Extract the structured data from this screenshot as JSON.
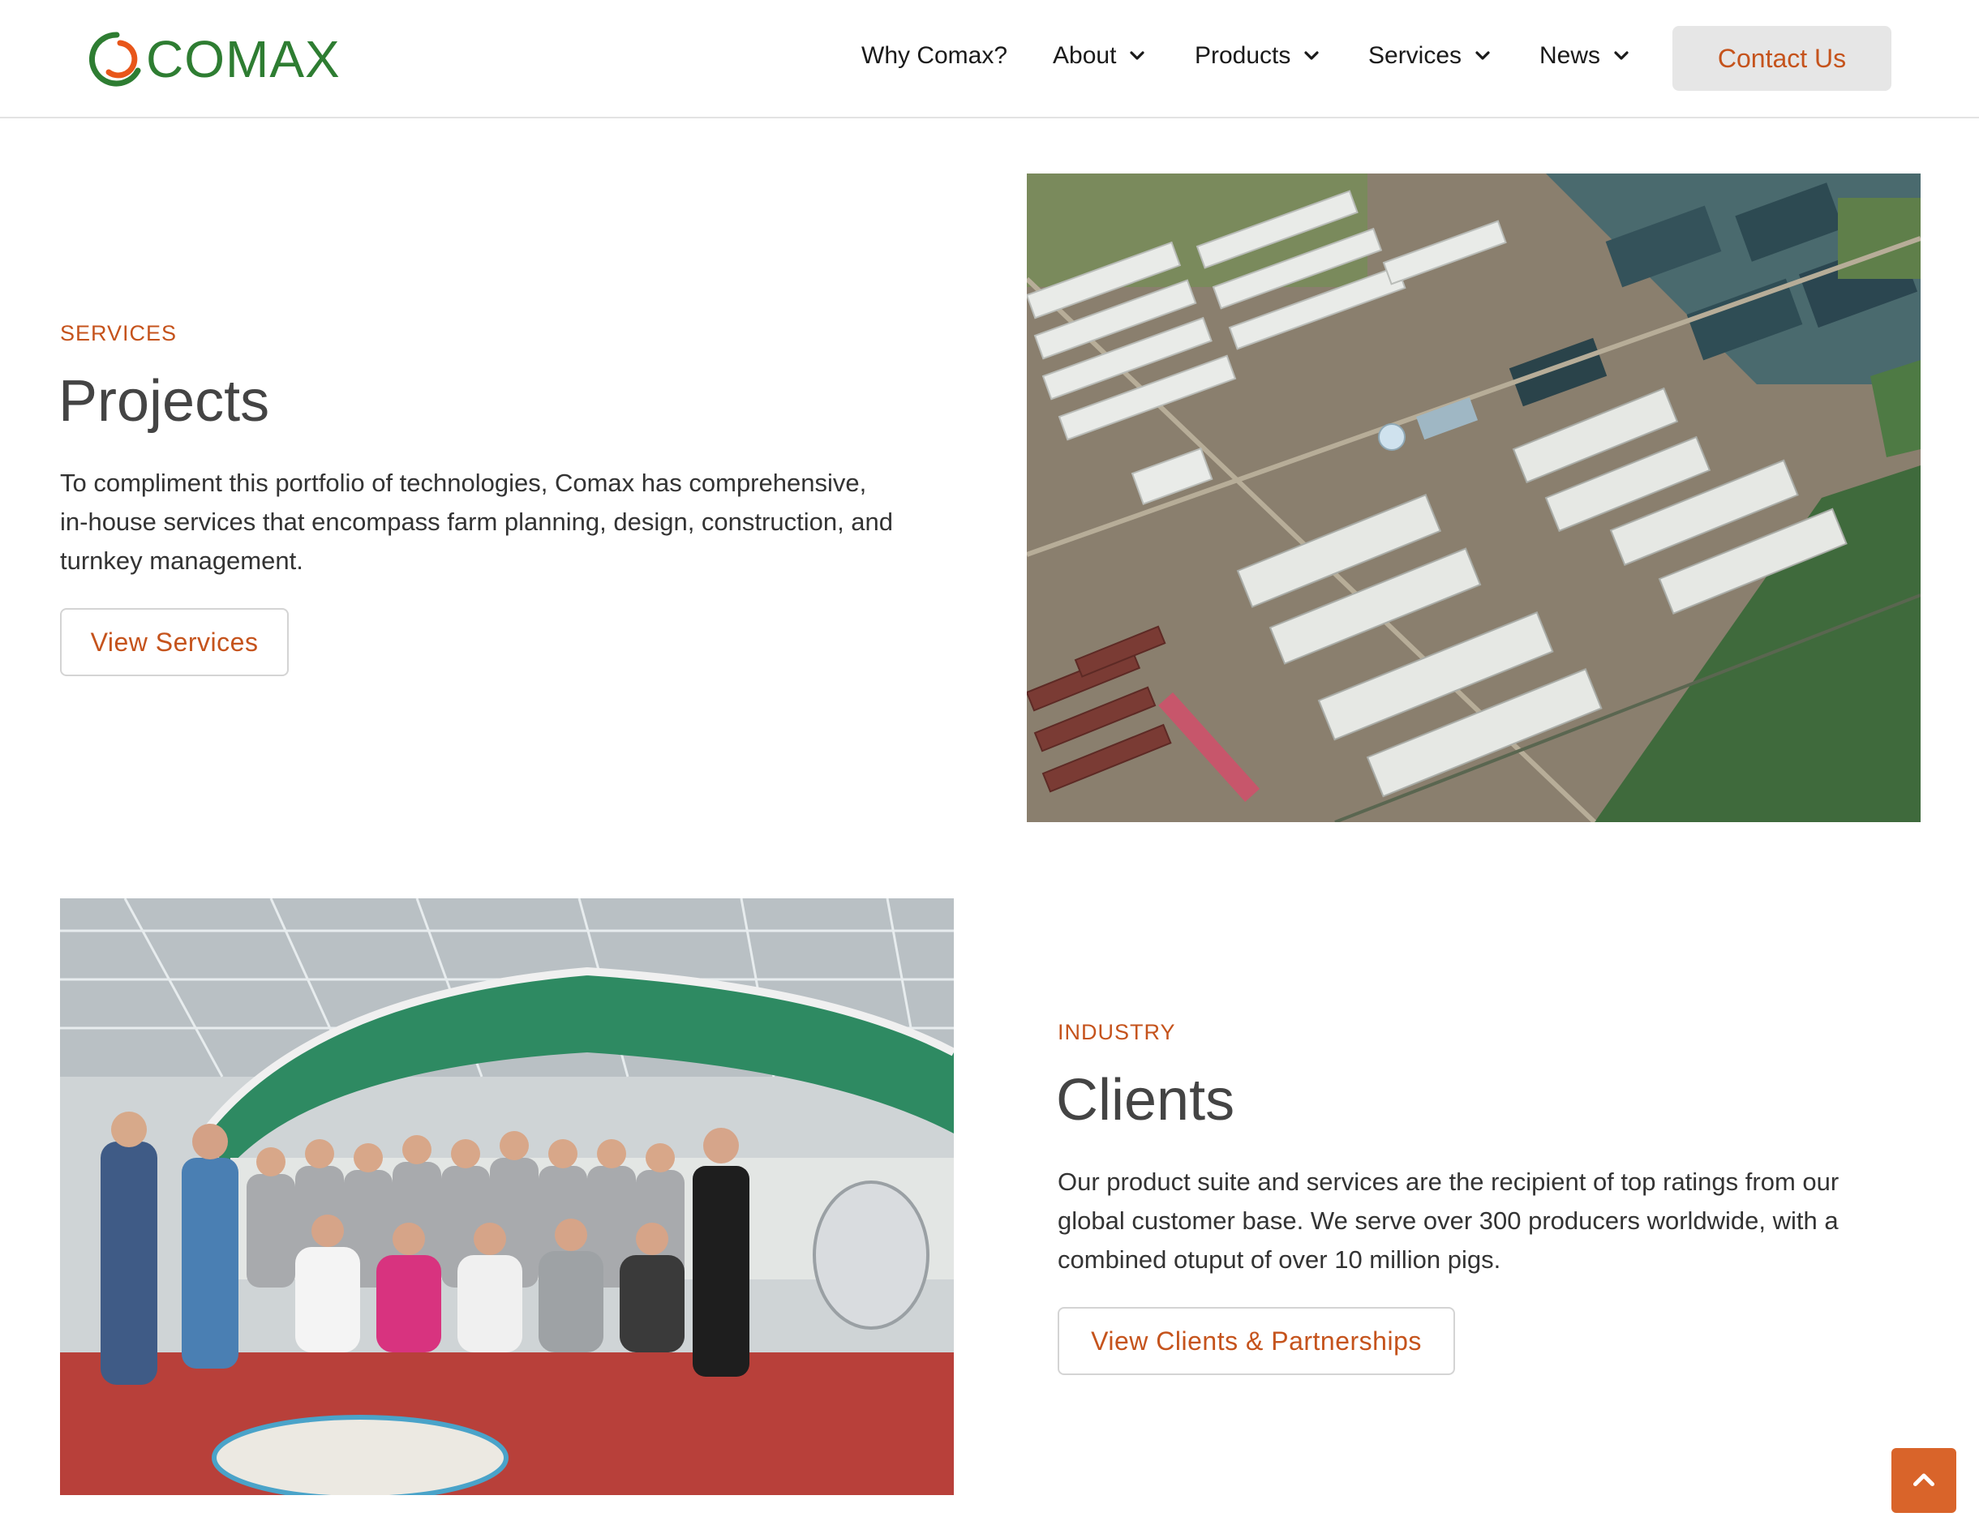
{
  "brand": {
    "name": "COMAX",
    "accent": "#c5531c",
    "logo_green": "#2e7d32"
  },
  "nav": {
    "items": [
      {
        "label": "Why Comax?",
        "has_dropdown": false
      },
      {
        "label": "About",
        "has_dropdown": true
      },
      {
        "label": "Products",
        "has_dropdown": true
      },
      {
        "label": "Services",
        "has_dropdown": true
      },
      {
        "label": "News",
        "has_dropdown": true
      }
    ],
    "contact_label": "Contact Us"
  },
  "projects": {
    "eyebrow": "SERVICES",
    "title": "Projects",
    "body_lines": [
      "To compliment this portfolio of technologies, Comax has comprehensive,",
      "in-house services that encompass farm planning, design, construction, and",
      "turnkey management."
    ],
    "button_label": "View Services"
  },
  "clients": {
    "eyebrow": "INDUSTRY",
    "title": "Clients",
    "body_lines": [
      "Our product suite and services are the recipient of top ratings from our",
      "global customer base. We serve over 300 producers worldwide, with a",
      "combined otuput of over 10 million pigs."
    ],
    "button_label": "View Clients & Partnerships"
  },
  "icons": {
    "scroll_top": "chevron-up-icon",
    "dropdown": "chevron-down-icon"
  }
}
